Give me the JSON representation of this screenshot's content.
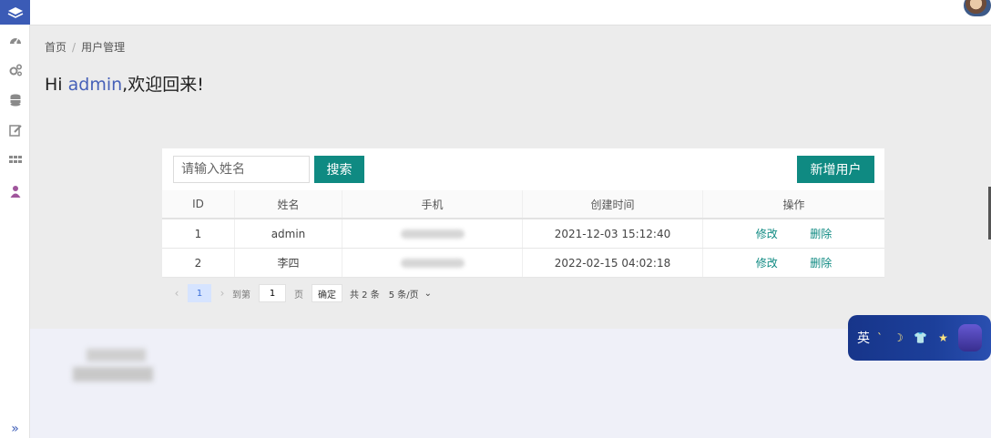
{
  "sidebar": {
    "items": [
      {
        "icon": "dashboard-icon"
      },
      {
        "icon": "gears-icon"
      },
      {
        "icon": "database-icon"
      },
      {
        "icon": "edit-icon"
      },
      {
        "icon": "grid-icon"
      },
      {
        "icon": "user-icon"
      }
    ],
    "collapse_label": "»"
  },
  "breadcrumb": {
    "home": "首页",
    "sep": "/",
    "current": "用户管理"
  },
  "greeting": {
    "prefix": "Hi ",
    "user": "admin",
    "suffix": ",欢迎回来!"
  },
  "toolbar": {
    "search_placeholder": "请输入姓名",
    "search_label": "搜索",
    "add_label": "新增用户"
  },
  "table": {
    "columns": [
      "ID",
      "姓名",
      "手机",
      "创建时间",
      "操作"
    ],
    "rows": [
      {
        "id": "1",
        "name": "admin",
        "time": "2021-12-03 15:12:40",
        "edit": "修改",
        "delete": "删除"
      },
      {
        "id": "2",
        "name": "李四",
        "time": "2022-02-15 04:02:18",
        "edit": "修改",
        "delete": "删除"
      }
    ]
  },
  "pagination": {
    "prev": "‹",
    "current_page": "1",
    "next": "›",
    "goto_label": "到第",
    "goto_value": "1",
    "page_unit": "页",
    "confirm": "确定",
    "total": "共 2 条",
    "page_size": "5 条/页",
    "page_size_chevron": "⌄"
  },
  "ime": {
    "lang": "英",
    "stars": "ˋ ☽ 👕 ★"
  },
  "colors": {
    "accent": "#0f8a82",
    "brand": "#3b5bb6",
    "link_user": "#4660b8"
  }
}
